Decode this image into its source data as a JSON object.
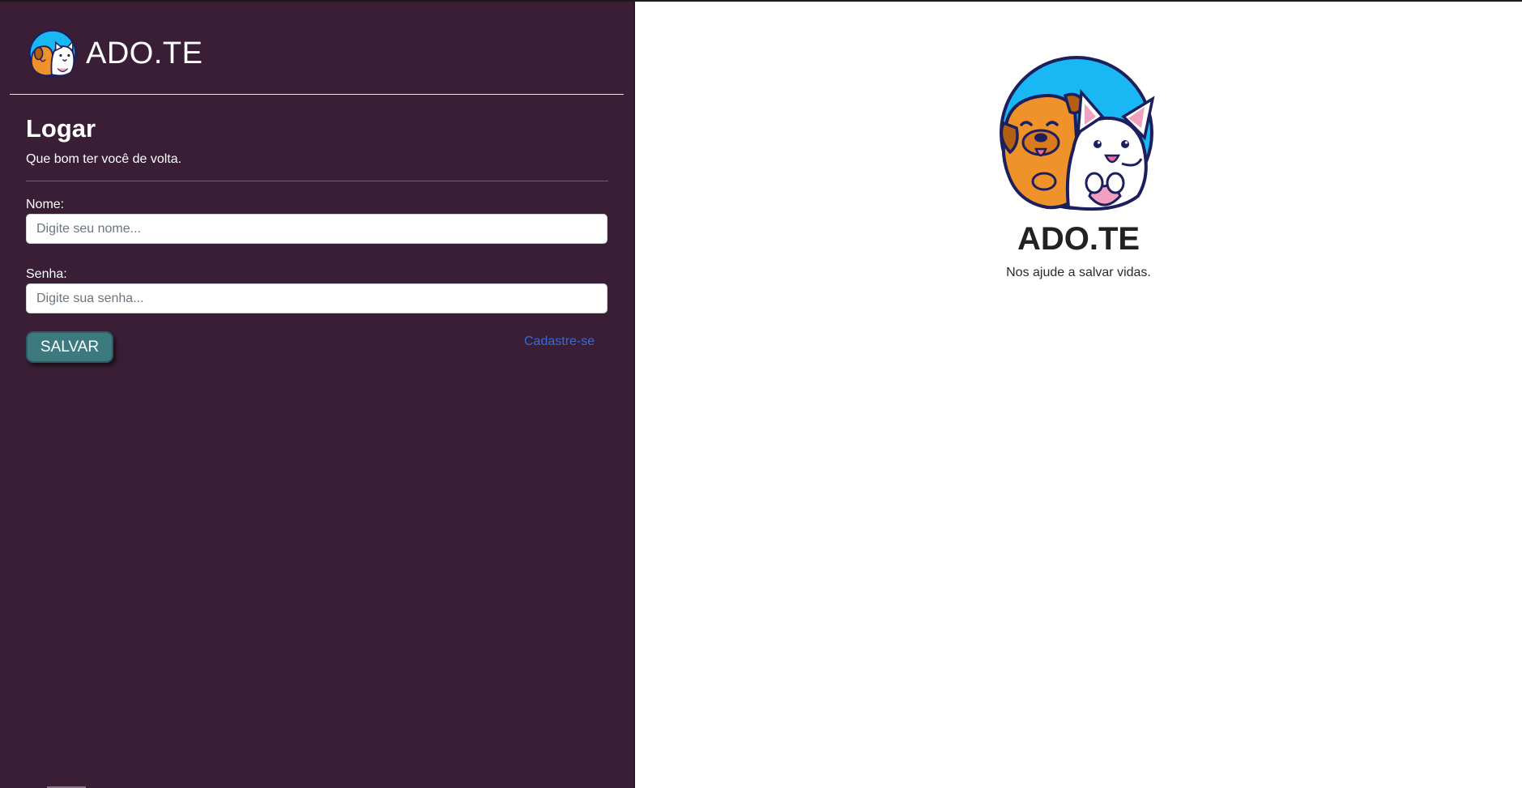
{
  "header": {
    "brand": "ADO.TE",
    "logo_icon": "dog-and-cat-logo-icon"
  },
  "login": {
    "heading": "Logar",
    "subtitle": "Que bom ter você de volta.",
    "name_label": "Nome:",
    "name_placeholder": "Digite seu nome...",
    "name_value": "",
    "password_label": "Senha:",
    "password_placeholder": "Digite sua senha...",
    "password_value": "",
    "save_label": "SALVAR",
    "register_label": "Cadastre-se"
  },
  "hero": {
    "brand": "ADO.TE",
    "tagline": "Nos ajude a salvar vidas.",
    "logo_icon": "dog-and-cat-logo-icon"
  },
  "colors": {
    "panel_background": "#3a1e35",
    "button_background": "#3c7a80",
    "link": "#2f6be6",
    "logo_circle": "#19b8f5",
    "dog": "#f0922a",
    "outline": "#1c1f5c"
  }
}
